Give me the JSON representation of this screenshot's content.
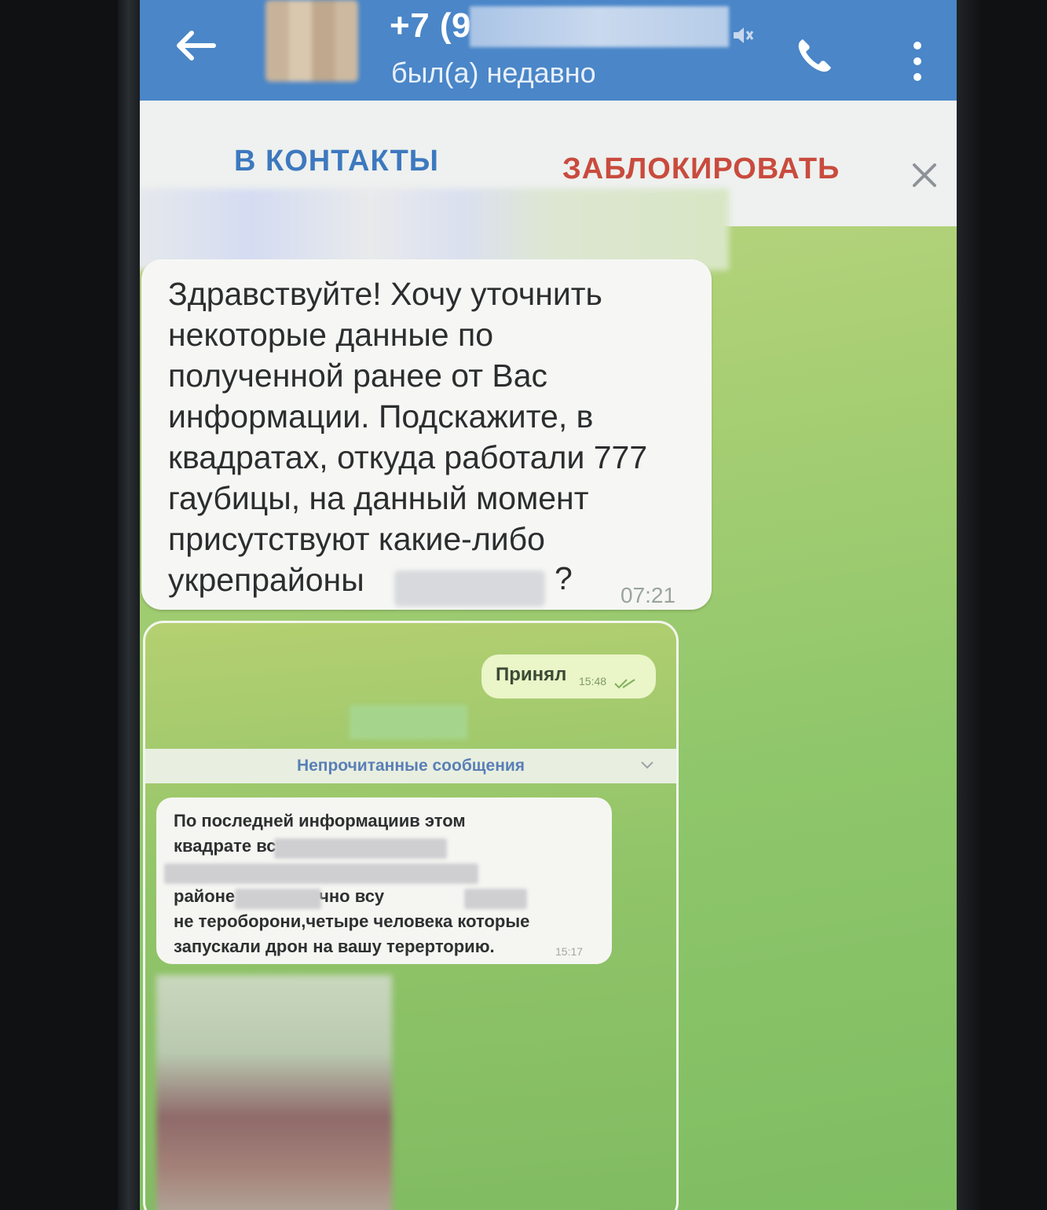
{
  "header": {
    "title": "+7 (9",
    "status": "был(а) недавно"
  },
  "action_bar": {
    "add_contact_label": "В КОНТАКТЫ",
    "block_label": "ЗАБЛОКИРОВАТЬ"
  },
  "messages": [
    {
      "text": "Здравствуйте! Хочу уточнить\nнекоторые данные по\nполученной ранее от Вас\nинформации. Подскажите, в\nквадратах, откуда работали 777\nгаубицы, на данный момент\nприсутствуют какие-либо\nукрепрайоны",
      "text_end": "?",
      "time": "07:21"
    }
  ],
  "embedded_screenshot": {
    "outgoing_text": "Принял",
    "outgoing_time": "15:48",
    "unread_label": "Непрочитанные сообщения",
    "incoming_text": "По последней информациив этом\nквадрате                                   всу,есть\n                                                         также в\nрайоне                     видел лично             всу\nне тероборони,четыре человека которые\nзапускали дрон на вашу терерторию.",
    "incoming_time": "15:17"
  },
  "colors": {
    "header_bg": "#4a86c8",
    "add_contact": "#3d79bf",
    "block": "#c94b3e",
    "chat_bg": "#8fc66b"
  }
}
